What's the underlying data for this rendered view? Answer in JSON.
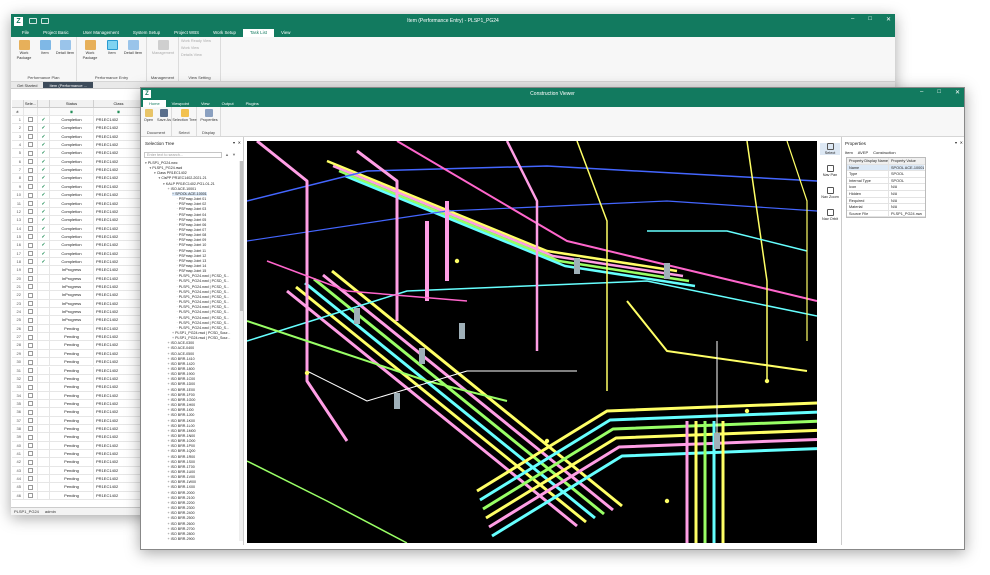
{
  "back_window": {
    "title": "Item (Performance Entry) - PLSP1_PG24",
    "app_icon": "logo-icon",
    "menu_tabs": [
      "File",
      "Project Basic",
      "User Management",
      "System Setup",
      "Project WBS",
      "Work Setup",
      "Task List",
      "View"
    ],
    "active_tab": "Task List",
    "ribbon_groups": [
      {
        "label": "Performance Plan",
        "buttons": [
          "Work Package",
          "Item",
          "Detail Item"
        ]
      },
      {
        "label": "Performance Entry",
        "buttons": [
          "Work Package",
          "Item",
          "Detail Item"
        ],
        "selected": "Item"
      },
      {
        "label": "Management",
        "buttons": [
          "Management"
        ]
      },
      {
        "label": "View Setting",
        "items": [
          "Work Ready View",
          "Work View",
          "Details View"
        ]
      }
    ],
    "doc_tabs": [
      "Get Started",
      "Item (Performance ..."
    ],
    "refresh_label": "REFRESH",
    "grid_headers": [
      "Sele...",
      "",
      "Status",
      "Class"
    ],
    "filter_row_marker": "≠",
    "rows": [
      {
        "n": "1",
        "checked": true,
        "status": "Completion",
        "class": "PR1EC1402"
      },
      {
        "n": "2",
        "checked": true,
        "status": "Completion",
        "class": "PR1EC1402"
      },
      {
        "n": "3",
        "checked": true,
        "status": "Completion",
        "class": "PR1EC1402"
      },
      {
        "n": "4",
        "checked": true,
        "status": "Completion",
        "class": "PR1EC1402"
      },
      {
        "n": "5",
        "checked": true,
        "status": "Completion",
        "class": "PR1EC1402"
      },
      {
        "n": "6",
        "checked": true,
        "status": "Completion",
        "class": "PR1EC1402"
      },
      {
        "n": "7",
        "checked": true,
        "status": "Completion",
        "class": "PR1EC1402"
      },
      {
        "n": "8",
        "checked": true,
        "status": "Completion",
        "class": "PR1EC1402"
      },
      {
        "n": "9",
        "checked": true,
        "status": "Completion",
        "class": "PR1EC1402"
      },
      {
        "n": "10",
        "checked": true,
        "status": "Completion",
        "class": "PR1EC1402"
      },
      {
        "n": "11",
        "checked": true,
        "status": "Completion",
        "class": "PR1EC1402"
      },
      {
        "n": "12",
        "checked": true,
        "status": "Completion",
        "class": "PR1EC1402"
      },
      {
        "n": "13",
        "checked": true,
        "status": "Completion",
        "class": "PR1EC1402"
      },
      {
        "n": "14",
        "checked": true,
        "status": "Completion",
        "class": "PR1EC1402"
      },
      {
        "n": "15",
        "checked": true,
        "status": "Completion",
        "class": "PR1EC1402"
      },
      {
        "n": "16",
        "checked": true,
        "status": "Completion",
        "class": "PR1EC1402"
      },
      {
        "n": "17",
        "checked": true,
        "status": "Completion",
        "class": "PR1EC1402"
      },
      {
        "n": "18",
        "checked": true,
        "status": "Completion",
        "class": "PR1EC1402"
      },
      {
        "n": "19",
        "checked": false,
        "status": "InProgress",
        "class": "PR1EC1402"
      },
      {
        "n": "20",
        "checked": false,
        "status": "InProgress",
        "class": "PR1EC1402"
      },
      {
        "n": "21",
        "checked": false,
        "status": "InProgress",
        "class": "PR1EC1402"
      },
      {
        "n": "22",
        "checked": false,
        "status": "InProgress",
        "class": "PR1EC1402"
      },
      {
        "n": "23",
        "checked": false,
        "status": "InProgress",
        "class": "PR1EC1402"
      },
      {
        "n": "24",
        "checked": false,
        "status": "InProgress",
        "class": "PR1EC1402"
      },
      {
        "n": "25",
        "checked": false,
        "status": "InProgress",
        "class": "PR1EC1402"
      },
      {
        "n": "26",
        "checked": false,
        "status": "Pending",
        "class": "PR1EC1402"
      },
      {
        "n": "27",
        "checked": false,
        "status": "Pending",
        "class": "PR1EC1402"
      },
      {
        "n": "28",
        "checked": false,
        "status": "Pending",
        "class": "PR1EC1402"
      },
      {
        "n": "29",
        "checked": false,
        "status": "Pending",
        "class": "PR1EC1402"
      },
      {
        "n": "30",
        "checked": false,
        "status": "Pending",
        "class": "PR1EC1402"
      },
      {
        "n": "31",
        "checked": false,
        "status": "Pending",
        "class": "PR1EC1402"
      },
      {
        "n": "32",
        "checked": false,
        "status": "Pending",
        "class": "PR1EC1402"
      },
      {
        "n": "33",
        "checked": false,
        "status": "Pending",
        "class": "PR1EC1402"
      },
      {
        "n": "34",
        "checked": false,
        "status": "Pending",
        "class": "PR1EC1402"
      },
      {
        "n": "35",
        "checked": false,
        "status": "Pending",
        "class": "PR1EC1402"
      },
      {
        "n": "36",
        "checked": false,
        "status": "Pending",
        "class": "PR1EC1402"
      },
      {
        "n": "37",
        "checked": false,
        "status": "Pending",
        "class": "PR1EC1402"
      },
      {
        "n": "38",
        "checked": false,
        "status": "Pending",
        "class": "PR1EC1402"
      },
      {
        "n": "39",
        "checked": false,
        "status": "Pending",
        "class": "PR1EC1402"
      },
      {
        "n": "40",
        "checked": false,
        "status": "Pending",
        "class": "PR1EC1402"
      },
      {
        "n": "41",
        "checked": false,
        "status": "Pending",
        "class": "PR1EC1402"
      },
      {
        "n": "42",
        "checked": false,
        "status": "Pending",
        "class": "PR1EC1402"
      },
      {
        "n": "43",
        "checked": false,
        "status": "Pending",
        "class": "PR1EC1402"
      },
      {
        "n": "44",
        "checked": false,
        "status": "Pending",
        "class": "PR1EC1402"
      },
      {
        "n": "45",
        "checked": false,
        "status": "Pending",
        "class": "PR1EC1402"
      },
      {
        "n": "46",
        "checked": false,
        "status": "Pending",
        "class": "PR1EC1402"
      },
      {
        "n": "47",
        "checked": false,
        "status": "Pending",
        "class": "PR1EC1402"
      },
      {
        "n": "48",
        "checked": false,
        "status": "Pending",
        "class": "PR1EC1402"
      }
    ],
    "status_bar": [
      "PLSP1_PG24",
      "admin"
    ]
  },
  "front_window": {
    "title": "Construction Viewer",
    "menu_tabs": [
      "Home",
      "Viewpoint",
      "View",
      "Output",
      "Plugins"
    ],
    "active_tab": "Home",
    "ribbon_groups": [
      {
        "label": "Document",
        "buttons": [
          "Open",
          "Save As"
        ]
      },
      {
        "label": "Select",
        "buttons": [
          "Selection Tree"
        ]
      },
      {
        "label": "Display",
        "buttons": [
          "Properties"
        ]
      }
    ],
    "selection_tree": {
      "title": "Selection Tree",
      "search_placeholder": "Enter text to search...",
      "nodes": [
        {
          "d": 0,
          "t": "PLSP1_PG24.nwc"
        },
        {
          "d": 1,
          "t": "PLSP1_PG24.nwd"
        },
        {
          "d": 2,
          "t": "Class PR1EC1402"
        },
        {
          "d": 3,
          "t": "ClsPP PR1EC1402-2021-21"
        },
        {
          "d": 4,
          "t": "KALP PR1EC1402-PG1-01-21"
        },
        {
          "d": 5,
          "t": "ISO ACE-10001"
        },
        {
          "d": 6,
          "t": "SPOOL ACE-10001",
          "sel": true
        },
        {
          "d": 7,
          "t": "PSFmap Joint 01"
        },
        {
          "d": 7,
          "t": "PSFmap Joint 02"
        },
        {
          "d": 7,
          "t": "PSFmap Joint 03"
        },
        {
          "d": 7,
          "t": "PSFmap Joint 04"
        },
        {
          "d": 7,
          "t": "PSFmap Joint 05"
        },
        {
          "d": 7,
          "t": "PSFmap Joint 06"
        },
        {
          "d": 7,
          "t": "PSFmap Joint 07"
        },
        {
          "d": 7,
          "t": "PSFmap Joint 08"
        },
        {
          "d": 7,
          "t": "PSFmap Joint 09"
        },
        {
          "d": 7,
          "t": "PSFmap Joint 10"
        },
        {
          "d": 7,
          "t": "PSFmap Joint 11"
        },
        {
          "d": 7,
          "t": "PSFmap Joint 12"
        },
        {
          "d": 7,
          "t": "PSFmap Joint 13"
        },
        {
          "d": 7,
          "t": "PSFmap Joint 14"
        },
        {
          "d": 7,
          "t": "PSFmap Joint 15"
        },
        {
          "d": 7,
          "t": "PLSP1_PG24.nwd | PCSD_S..."
        },
        {
          "d": 7,
          "t": "PLSP1_PG24.nwd | PCSD_S..."
        },
        {
          "d": 7,
          "t": "PLSP1_PG24.nwd | PCSD_S..."
        },
        {
          "d": 7,
          "t": "PLSP1_PG24.nwd | PCSD_S..."
        },
        {
          "d": 7,
          "t": "PLSP1_PG24.nwd | PCSD_S..."
        },
        {
          "d": 7,
          "t": "PLSP1_PG24.nwd | PCSD_S..."
        },
        {
          "d": 7,
          "t": "PLSP1_PG24.nwd | PCSD_S..."
        },
        {
          "d": 7,
          "t": "PLSP1_PG24.nwd | PCSD_S..."
        },
        {
          "d": 7,
          "t": "PLSP1_PG24.nwd | PCSD_S..."
        },
        {
          "d": 7,
          "t": "PLSP1_PG24.nwd | PCSD_S..."
        },
        {
          "d": 7,
          "t": "PLSP1_PG24.nwd | PCSD_S..."
        },
        {
          "d": 6,
          "t": "PLSP1_PG24.nwd | PCSD_Sour..."
        },
        {
          "d": 6,
          "t": "PLSP1_PG24.nwd | PCSD_Sour..."
        },
        {
          "d": 5,
          "t": "ISO ACE-0300"
        },
        {
          "d": 5,
          "t": "ISO ACE-0400"
        },
        {
          "d": 5,
          "t": "ISO ACE-0500"
        },
        {
          "d": 5,
          "t": "ISO BRR-1410"
        },
        {
          "d": 5,
          "t": "ISO BRR-1420"
        },
        {
          "d": 5,
          "t": "ISO BRR-1800"
        },
        {
          "d": 5,
          "t": "ISO BRR-1900"
        },
        {
          "d": 5,
          "t": "ISO BRR-1C00"
        },
        {
          "d": 5,
          "t": "ISO BRR-1D00"
        },
        {
          "d": 5,
          "t": "ISO BRR-1E00"
        },
        {
          "d": 5,
          "t": "ISO BRR-1F00"
        },
        {
          "d": 5,
          "t": "ISO BRR-1G00"
        },
        {
          "d": 5,
          "t": "ISO BRR-1H00"
        },
        {
          "d": 5,
          "t": "ISO BRR-1I00"
        },
        {
          "d": 5,
          "t": "ISO BRR-1J00"
        },
        {
          "d": 5,
          "t": "ISO BRR-1K00"
        },
        {
          "d": 5,
          "t": "ISO BRR-1L00"
        },
        {
          "d": 5,
          "t": "ISO BRR-1M00"
        },
        {
          "d": 5,
          "t": "ISO BRR-1N00"
        },
        {
          "d": 5,
          "t": "ISO BRR-1O00"
        },
        {
          "d": 5,
          "t": "ISO BRR-1P00"
        },
        {
          "d": 5,
          "t": "ISO BRR-1Q00"
        },
        {
          "d": 5,
          "t": "ISO BRR-1R00"
        },
        {
          "d": 5,
          "t": "ISO BRR-1S00"
        },
        {
          "d": 5,
          "t": "ISO BRR-1T00"
        },
        {
          "d": 5,
          "t": "ISO BRR-1U00"
        },
        {
          "d": 5,
          "t": "ISO BRR-1V00"
        },
        {
          "d": 5,
          "t": "ISO BRR-1W00"
        },
        {
          "d": 5,
          "t": "ISO BRR-1X00"
        },
        {
          "d": 5,
          "t": "ISO BRR-2000"
        },
        {
          "d": 5,
          "t": "ISO BRR-2100"
        },
        {
          "d": 5,
          "t": "ISO BRR-2200"
        },
        {
          "d": 5,
          "t": "ISO BRR-2300"
        },
        {
          "d": 5,
          "t": "ISO BRR-2400"
        },
        {
          "d": 5,
          "t": "ISO BRR-2500"
        },
        {
          "d": 5,
          "t": "ISO BRR-2600"
        },
        {
          "d": 5,
          "t": "ISO BRR-2700"
        },
        {
          "d": 5,
          "t": "ISO BRR-2800"
        },
        {
          "d": 5,
          "t": "ISO BRR-2900"
        }
      ]
    },
    "nav_tools": [
      {
        "label": "Select",
        "icon": "cursor-icon",
        "selected": true
      },
      {
        "label": "Nav Pan",
        "icon": "hand-icon"
      },
      {
        "label": "Nav Zoom",
        "icon": "zoom-icon"
      },
      {
        "label": "Nav Orbit",
        "icon": "orbit-icon"
      }
    ],
    "properties": {
      "title": "Properties",
      "tabs": [
        "Item",
        "AVEP",
        "Construction"
      ],
      "header": [
        "Property Display Name",
        "Property Value"
      ],
      "rows": [
        {
          "name": "Name",
          "value": "SPOOL ACE-10001",
          "sel": true
        },
        {
          "name": "Type",
          "value": "SPOOL"
        },
        {
          "name": "Internal Type",
          "value": "SPOOL"
        },
        {
          "name": "Icon",
          "value": "N/A"
        },
        {
          "name": "Hidden",
          "value": "N/A"
        },
        {
          "name": "Required",
          "value": "N/A"
        },
        {
          "name": "Material",
          "value": "N/A"
        },
        {
          "name": "Source File",
          "value": "PLSP1_PG24.nwc"
        }
      ]
    },
    "pipe_colors": [
      "#ff9ee5",
      "#ffff66",
      "#66ffff",
      "#99ff66",
      "#ffffff",
      "#4466ff",
      "#ff66cc"
    ]
  }
}
